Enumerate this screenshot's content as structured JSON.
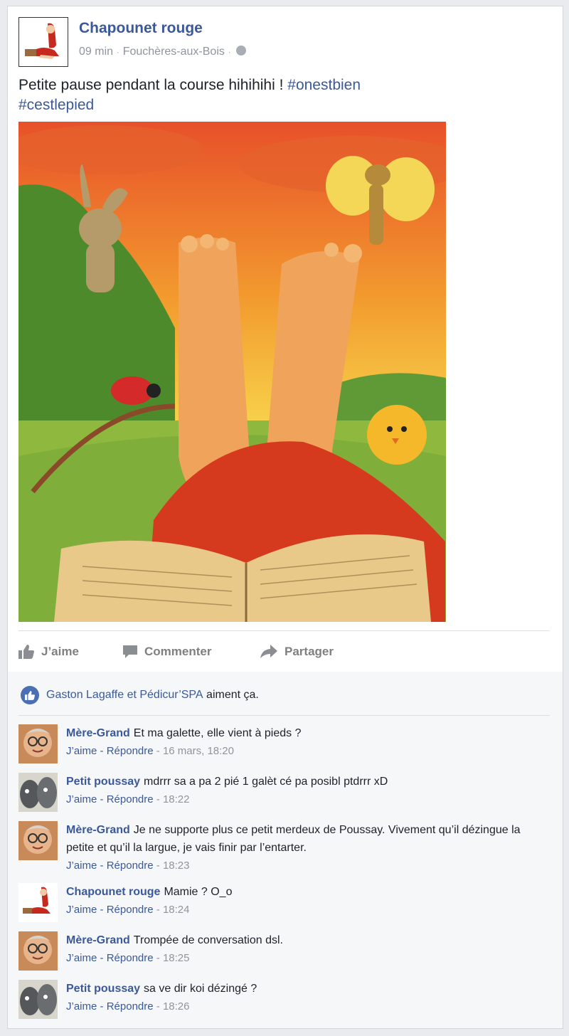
{
  "post": {
    "author": "Chapounet rouge",
    "time": "09 min",
    "location": "Fouchères-aux-Bois",
    "text": "Petite pause pendant la course hihihihi ! ",
    "hashtag1": "#onestbien",
    "hashtag2": "#cestlepied",
    "image_alt": "Illustration: pieds nus sur l'herbe avec un livre, lapin, coccinelle, papillon et poussin"
  },
  "actions": {
    "like": "J’aime",
    "comment": "Commenter",
    "share": "Partager"
  },
  "likes": {
    "names": "Gaston Lagaffe et Pédicur’SPA",
    "suffix": " aiment ça."
  },
  "comment_meta": {
    "like": "J’aime",
    "sep": " - ",
    "reply": "Répondre"
  },
  "comments": [
    {
      "author": "Mère-Grand",
      "text": "Et ma galette, elle vient à pieds ?",
      "time": "16 mars, 18:20",
      "avatar": "grandma"
    },
    {
      "author": "Petit poussay",
      "text": "mdrrr sa a pa 2 pié 1 galèt cé pa posibl ptdrrr xD",
      "time": "18:22",
      "avatar": "stones"
    },
    {
      "author": "Mère-Grand",
      "text": "Je ne supporte plus ce petit merdeux de Poussay. Vivement qu’il dézingue la petite et qu’il la largue, je vais finir par l’entarter.",
      "time": "18:23",
      "avatar": "grandma"
    },
    {
      "author": "Chapounet rouge",
      "text": "Mamie ? O_o",
      "time": "18:24",
      "avatar": "redhood"
    },
    {
      "author": "Mère-Grand",
      "text": "Trompée de conversation dsl.",
      "time": "18:25",
      "avatar": "grandma"
    },
    {
      "author": "Petit poussay",
      "text": "sa ve dir koi dézingé ?",
      "time": "18:26",
      "avatar": "stones"
    }
  ],
  "colors": {
    "link": "#3b5998",
    "meta": "#90949c",
    "like_badge": "#4a6fb5"
  }
}
